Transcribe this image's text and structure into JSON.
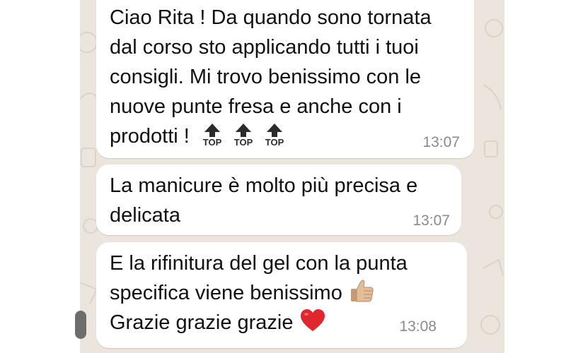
{
  "messages": [
    {
      "lines": [
        "Ciao Rita ! Da quando sono tornata",
        "dal corso sto applicando tutti i tuoi",
        "consigli.  Mi trovo benissimo con le",
        "nuove punte fresa e anche con i",
        "prodotti !"
      ],
      "emojis": [
        "TOP",
        "TOP",
        "TOP"
      ],
      "time": "13:07"
    },
    {
      "lines": [
        "La manicure è molto più precisa e",
        "delicata"
      ],
      "time": "13:07"
    },
    {
      "lines": [
        "E la rifinitura del gel con la punta",
        "specifica viene benissimo",
        "Grazie grazie grazie"
      ],
      "time": "13:08"
    }
  ],
  "icons": {
    "top_arrow": "top-arrow-icon",
    "thumbs_up": "thumbs-up-icon",
    "heart": "red-heart-icon"
  },
  "colors": {
    "chat_background": "#ece5dd",
    "bubble": "#ffffff",
    "timestamp": "#8a8a8a",
    "heart": "#e0262f"
  }
}
